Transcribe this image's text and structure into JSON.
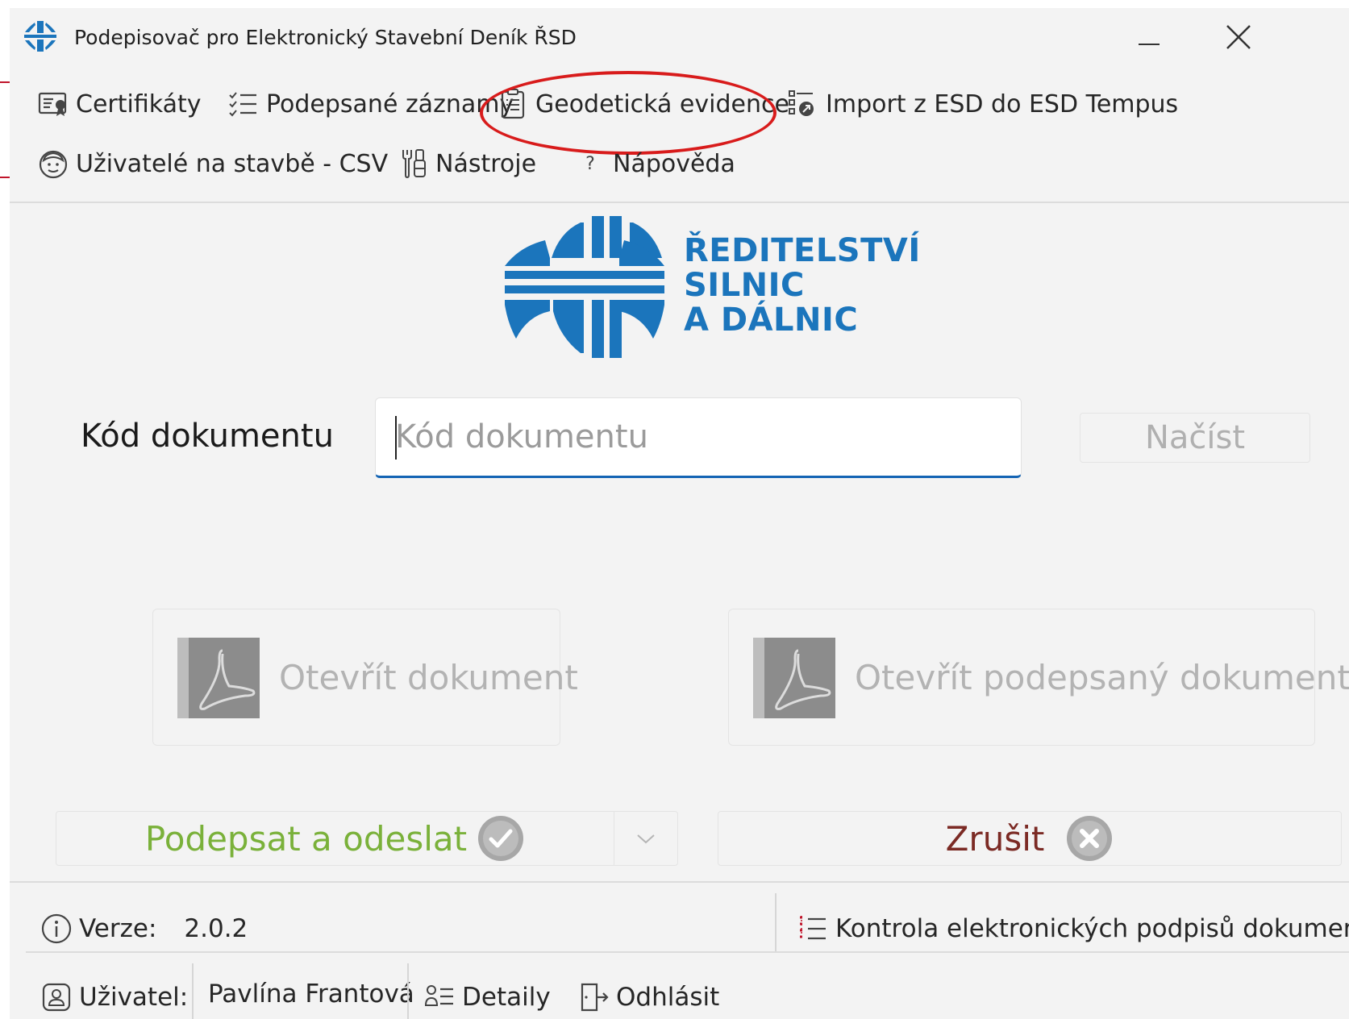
{
  "window": {
    "title": "Podepisovač pro Elektronický Stavební Deník ŘSD"
  },
  "menu": {
    "items": [
      {
        "label": "Certifikáty",
        "icon": "certificate-icon"
      },
      {
        "label": "Podepsané záznamy",
        "icon": "checklist-icon"
      },
      {
        "label": "Geodetická evidence",
        "icon": "clipboard-icon"
      },
      {
        "label": "Import z ESD do ESD Tempus",
        "icon": "import-list-icon"
      },
      {
        "label": "Uživatelé na stavbě - CSV",
        "icon": "users-face-icon"
      },
      {
        "label": "Nástroje",
        "icon": "tools-icon"
      },
      {
        "label": "Nápověda",
        "icon": "help-icon"
      }
    ],
    "help_glyph": "?",
    "highlighted_item": "Geodetická evidence",
    "highlight_color": "#d81b1b"
  },
  "logo": {
    "lines": [
      "ŘEDITELSTVÍ",
      "SILNIC",
      "A DÁLNIC"
    ],
    "color": "#1b75bc"
  },
  "document": {
    "code_label": "Kód dokumentu",
    "code_placeholder": "Kód dokumentu",
    "code_value": "",
    "load_label": "Načíst"
  },
  "actions": {
    "open_document": "Otevřít dokument",
    "open_signed_document": "Otevřít podepsaný dokument",
    "sign_and_send": "Podepsat a odeslat",
    "cancel": "Zrušit"
  },
  "status": {
    "version_label": "Verze:",
    "version_value": "2.0.2",
    "verify_signatures": "Kontrola elektronických podpisů dokumentu",
    "user_label": "Uživatel:",
    "user_name": "Pavlína Frantová",
    "details": "Detaily",
    "logout": "Odhlásit"
  },
  "colors": {
    "accent": "#1464b4",
    "sign_green": "#7ab13a",
    "cancel_red": "#7b2a24",
    "annotation_red": "#c0152b"
  }
}
